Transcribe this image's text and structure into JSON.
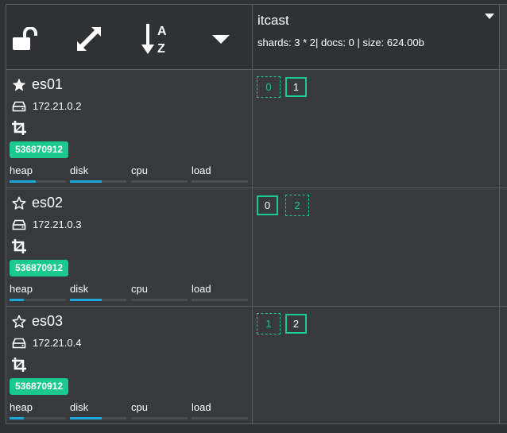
{
  "toolbar": {
    "icons": [
      "unlock-icon",
      "expand-icon",
      "sort-az-icon",
      "caret-down-icon"
    ]
  },
  "index": {
    "name": "itcast",
    "meta": "shards: 3 * 2| docs: 0 | size: 624.00b"
  },
  "nodes": [
    {
      "name": "es01",
      "master": true,
      "ip": "172.21.0.2",
      "badge": "536870912",
      "metrics": [
        {
          "label": "heap",
          "level": 0.47
        },
        {
          "label": "disk",
          "level": 0.57
        },
        {
          "label": "cpu",
          "level": 0.0
        },
        {
          "label": "load",
          "level": 0.0
        }
      ],
      "shards": [
        {
          "id": "0",
          "type": "replica"
        },
        {
          "id": "1",
          "type": "primary"
        }
      ]
    },
    {
      "name": "es02",
      "master": false,
      "ip": "172.21.0.3",
      "badge": "536870912",
      "metrics": [
        {
          "label": "heap",
          "level": 0.25
        },
        {
          "label": "disk",
          "level": 0.57
        },
        {
          "label": "cpu",
          "level": 0.0
        },
        {
          "label": "load",
          "level": 0.0
        }
      ],
      "shards": [
        {
          "id": "0",
          "type": "primary"
        },
        {
          "id": "2",
          "type": "replica"
        }
      ]
    },
    {
      "name": "es03",
      "master": false,
      "ip": "172.21.0.4",
      "badge": "536870912",
      "metrics": [
        {
          "label": "heap",
          "level": 0.25
        },
        {
          "label": "disk",
          "level": 0.57
        },
        {
          "label": "cpu",
          "level": 0.0
        },
        {
          "label": "load",
          "level": 0.0
        }
      ],
      "shards": [
        {
          "id": "1",
          "type": "replica"
        },
        {
          "id": "2",
          "type": "primary"
        }
      ]
    }
  ],
  "colors": {
    "accent": "#1bc98e",
    "meter": "#1ca8dd",
    "background": "#363a3d"
  }
}
